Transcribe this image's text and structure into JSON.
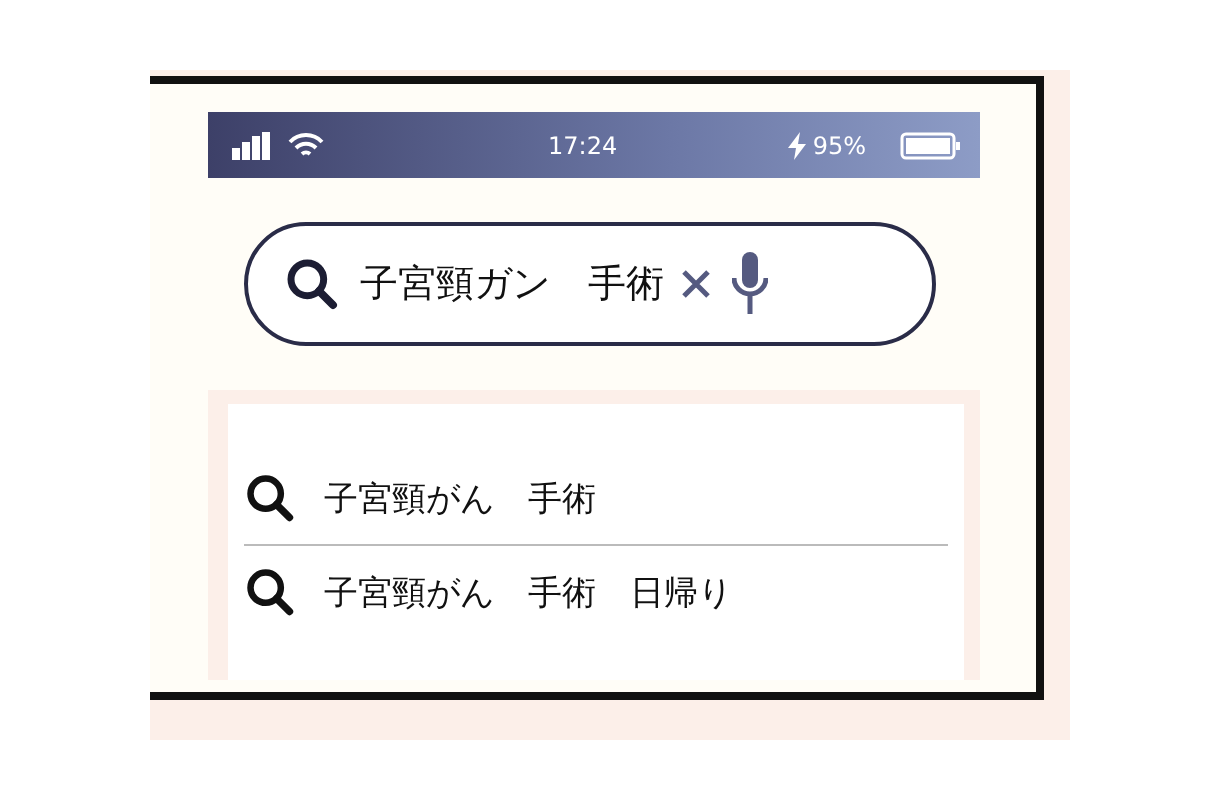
{
  "status_bar": {
    "time": "17:24",
    "battery": "95%"
  },
  "search": {
    "value": "子宮頸ガン　手術"
  },
  "suggestions": [
    {
      "text": "子宮頸がん　手術"
    },
    {
      "text": "子宮頸がん　手術　日帰り"
    }
  ]
}
